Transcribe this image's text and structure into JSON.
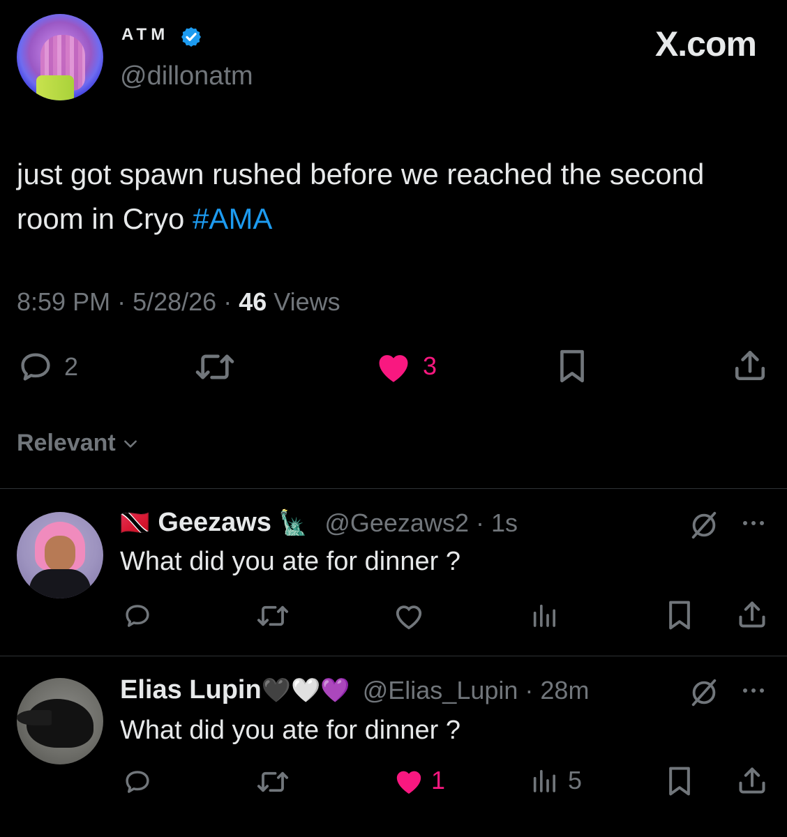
{
  "brand": "X.com",
  "tweet": {
    "author_name": "ATM",
    "author_handle": "@dillonatm",
    "text_plain": "just got spawn rushed before we reached the second room in Cryo",
    "hashtag": "#AMA",
    "time": "8:59 PM",
    "date": "5/28/26",
    "views_count": "46",
    "views_label": "Views",
    "replies": "2",
    "likes": "3"
  },
  "sort": {
    "label": "Relevant"
  },
  "replies": [
    {
      "name": "Geezaws",
      "handle": "@Geezaws2",
      "age": "1s",
      "text": "What did you ate for dinner ?",
      "name_emoji": "🗽",
      "flag_emoji": "🇹🇹"
    },
    {
      "name": "Elias Lupin",
      "handle": "@Elias_Lupin",
      "age": "28m",
      "text": "What did you ate for dinner ?",
      "hearts": "🖤🤍💜",
      "likes": "1",
      "views": "5"
    }
  ],
  "colors": {
    "background": "#000000",
    "text": "#e7e9ea",
    "muted": "#71767b",
    "accent": "#1d9bf0",
    "like": "#f91880"
  }
}
